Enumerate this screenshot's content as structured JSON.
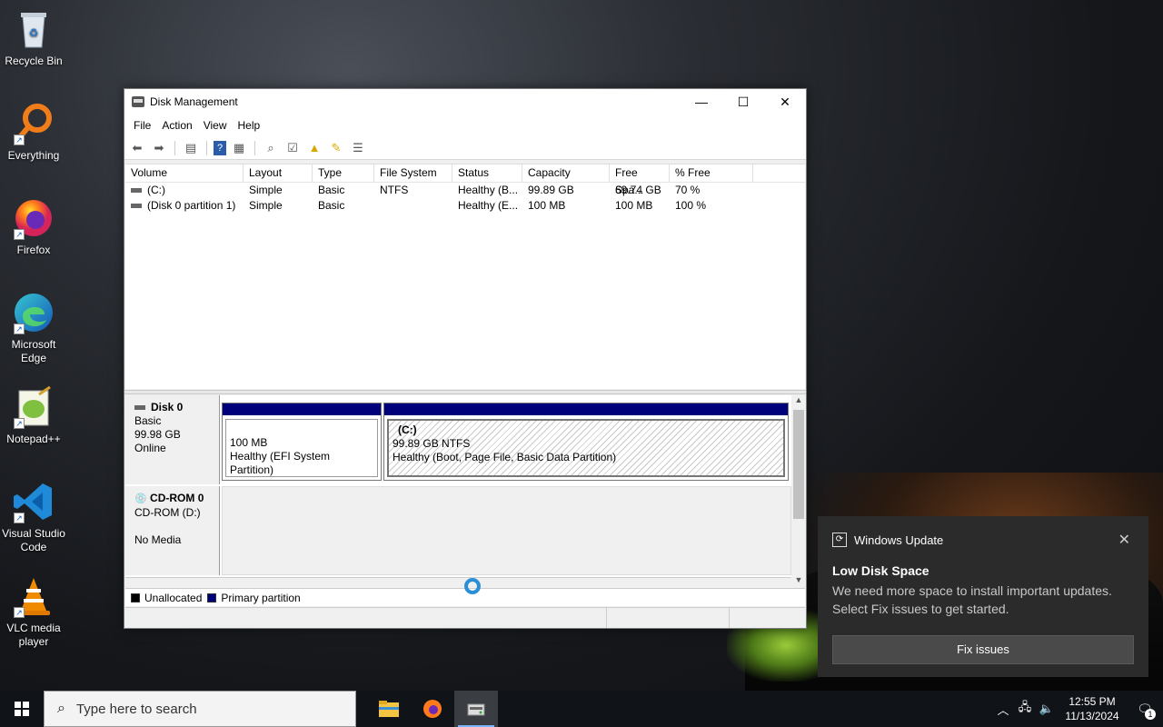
{
  "desktop": {
    "icons": [
      {
        "label": "Recycle Bin"
      },
      {
        "label": "Everything"
      },
      {
        "label": "Firefox"
      },
      {
        "label": "Microsoft Edge"
      },
      {
        "label": "Notepad++"
      },
      {
        "label": "Visual Studio Code"
      },
      {
        "label": "VLC media player"
      }
    ]
  },
  "window": {
    "title": "Disk Management",
    "controls": {
      "minimize": "—",
      "maximize": "☐",
      "close": "✕"
    },
    "menu": [
      "File",
      "Action",
      "View",
      "Help"
    ],
    "columns": [
      "Volume",
      "Layout",
      "Type",
      "File System",
      "Status",
      "Capacity",
      "Free Spa...",
      "% Free"
    ],
    "volumes": [
      {
        "volume": "(C:)",
        "layout": "Simple",
        "type": "Basic",
        "fs": "NTFS",
        "status": "Healthy (B...",
        "capacity": "99.89 GB",
        "free": "69.74 GB",
        "pct": "70 %"
      },
      {
        "volume": "(Disk 0 partition 1)",
        "layout": "Simple",
        "type": "Basic",
        "fs": "",
        "status": "Healthy (E...",
        "capacity": "100 MB",
        "free": "100 MB",
        "pct": "100 %"
      }
    ],
    "disk0": {
      "name": "Disk 0",
      "type": "Basic",
      "size": "99.98 GB",
      "state": "Online",
      "partitions": [
        {
          "title": "",
          "size": "100 MB",
          "status": "Healthy (EFI System Partition)"
        },
        {
          "title": "(C:)",
          "size": "99.89 GB NTFS",
          "status": "Healthy (Boot, Page File, Basic Data Partition)"
        }
      ]
    },
    "cdrom": {
      "name": "CD-ROM 0",
      "drive": "CD-ROM (D:)",
      "state": "No Media"
    },
    "legend": [
      {
        "label": "Unallocated",
        "color": "#000000"
      },
      {
        "label": "Primary partition",
        "color": "#00007a"
      }
    ]
  },
  "toast": {
    "app": "Windows Update",
    "heading": "Low Disk Space",
    "message": "We need more space to install important updates. Select Fix issues to get started.",
    "button": "Fix issues"
  },
  "taskbar": {
    "search_placeholder": "Type here to search",
    "time": "12:55 PM",
    "date": "11/13/2024",
    "notification_count": "1"
  }
}
